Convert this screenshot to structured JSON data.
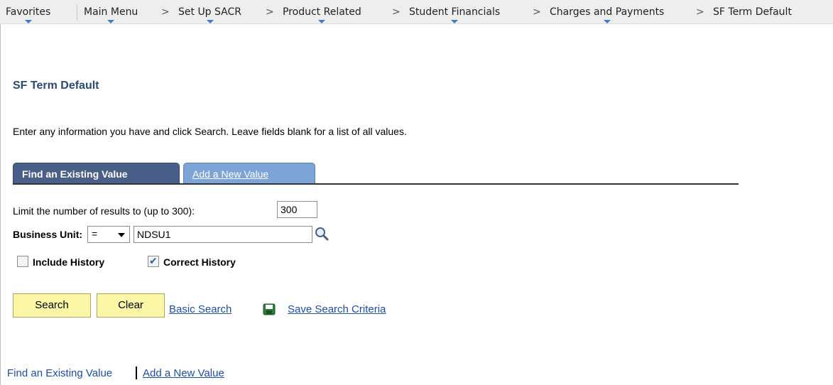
{
  "breadcrumb": {
    "favorites": "Favorites",
    "main_menu": "Main Menu",
    "set_up_sacr": "Set Up SACR",
    "product_related": "Product Related",
    "student_financials": "Student Financials",
    "charges_and_payments": "Charges and Payments",
    "current": "SF Term Default",
    "separator": ">"
  },
  "page": {
    "title": "SF Term Default",
    "instructions": "Enter any information you have and click Search. Leave fields blank for a list of all values."
  },
  "tabs": {
    "find_existing": "Find an Existing Value",
    "add_new": "Add a New Value"
  },
  "search": {
    "limit_label": "Limit the number of results to (up to 300):",
    "limit_value": "300",
    "business_unit_label": "Business Unit:",
    "operator": "=",
    "business_unit_value": "NDSU1",
    "include_history_label": "Include History",
    "include_history_checked": false,
    "correct_history_label": "Correct History",
    "correct_history_checked": true
  },
  "actions": {
    "search_button": "Search",
    "clear_button": "Clear",
    "basic_search_link": "Basic Search",
    "save_criteria_link": "Save Search Criteria"
  },
  "footer": {
    "find_existing": "Find an Existing Value",
    "add_new": "Add a New Value"
  },
  "colors": {
    "title": "#2b4a72",
    "tab_active": "#4a5e8a",
    "tab_inactive": "#7da4d6",
    "button_bg": "#fbf7a6",
    "link": "#1d4fa6",
    "dropdown_indicator": "#3d7bc2"
  }
}
